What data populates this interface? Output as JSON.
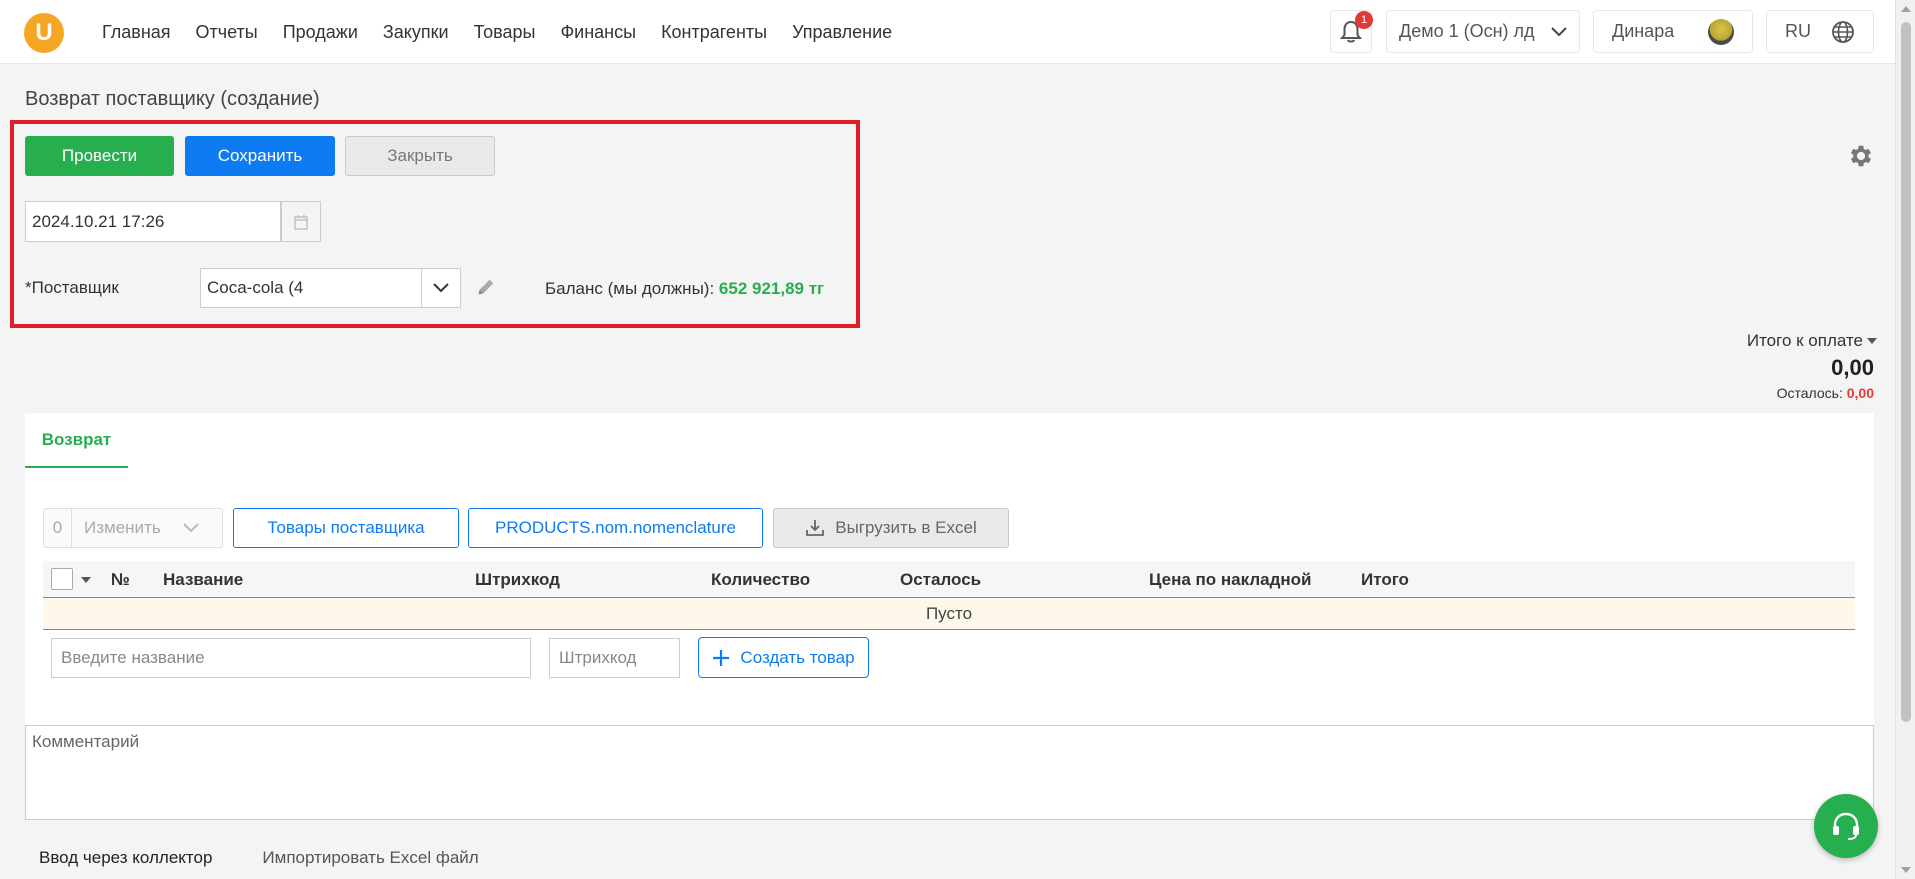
{
  "nav": {
    "items": [
      "Главная",
      "Отчеты",
      "Продажи",
      "Закупки",
      "Товары",
      "Финансы",
      "Контрагенты",
      "Управление"
    ],
    "logo_letter": "U",
    "notifications_count": "1",
    "company": "Демо 1 (Осн) лд",
    "user": "Динара",
    "lang": "RU"
  },
  "page": {
    "title": "Возврат поставщику (создание)"
  },
  "actions": {
    "post": "Провести",
    "save": "Сохранить",
    "close": "Закрыть"
  },
  "form": {
    "date_value": "2024.10.21 17:26",
    "supplier_label": "*Поставщик",
    "supplier_value": "Coca-cola (4",
    "balance_label": "Баланс (мы должны): ",
    "balance_value": "652 921,89 тг"
  },
  "totals": {
    "label": "Итого к оплате",
    "value": "0,00",
    "remain_label": "Осталось: ",
    "remain_value": "0,00"
  },
  "tabs": {
    "return": "Возврат"
  },
  "toolbar": {
    "count": "0",
    "change": "Изменить",
    "supplier_products": "Товары поставщика",
    "products_nom": "PRODUCTS.nom.nomenclature",
    "export_excel": "Выгрузить в Excel"
  },
  "table": {
    "columns": [
      "№",
      "Название",
      "Штрихкод",
      "Количество",
      "Осталось",
      "Цена по накладной",
      "Итого"
    ],
    "empty": "Пусто"
  },
  "add_row": {
    "name_placeholder": "Введите название",
    "barcode_placeholder": "Штрихкод",
    "create_product": "Создать товар"
  },
  "comment": {
    "placeholder": "Комментарий"
  },
  "bottom_tabs": [
    "Ввод через коллектор",
    "Импортировать Excel файл"
  ],
  "colors": {
    "green": "#27ae4f",
    "blue": "#0d7cf2",
    "red": "#e11d2a",
    "brand": "#f5a623"
  }
}
